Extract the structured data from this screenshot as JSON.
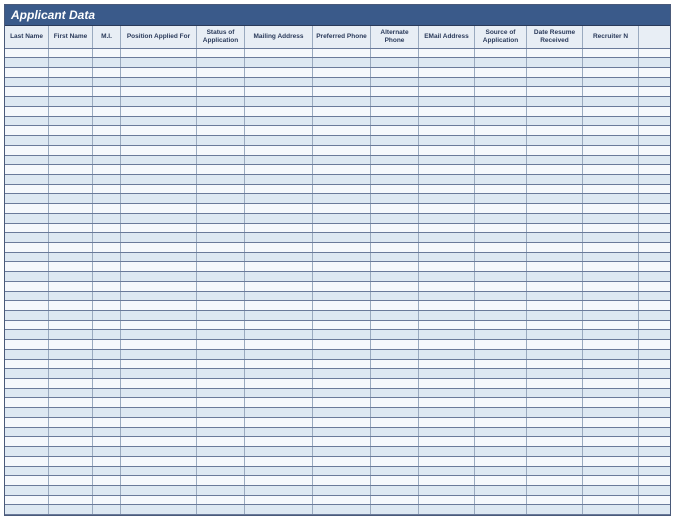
{
  "title": "Applicant Data",
  "columns": [
    "Last Name",
    "First Name",
    "M.I.",
    "Position Applied For",
    "Status of Application",
    "Mailing Address",
    "Preferred Phone",
    "Alternate Phone",
    "EMail Address",
    "Source of Application",
    "Date Resume Received",
    "Recruiter N"
  ],
  "row_count": 48
}
